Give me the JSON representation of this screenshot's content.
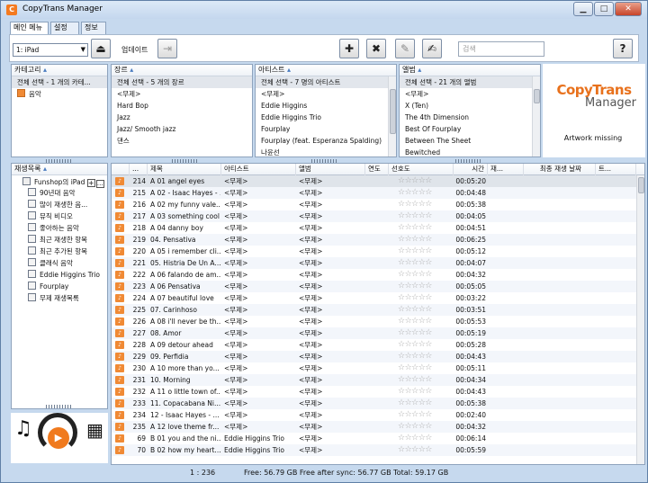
{
  "window": {
    "title": "CopyTrans Manager",
    "minimize": "▁",
    "maximize": "□",
    "close": "✕"
  },
  "tabs": [
    "메인 메뉴",
    "설정",
    "정보"
  ],
  "toolbar": {
    "device": "1: iPad",
    "update_label": "업데이트",
    "search_placeholder": "검색",
    "help_label": "?"
  },
  "categories": {
    "header": "카테고리",
    "items": [
      "전체 선택 - 1 개의 카테...",
      "음악"
    ]
  },
  "genres": {
    "header": "장르",
    "items": [
      "전체 선택 - 5 개의 장르",
      "<무제>",
      "Hard Bop",
      "Jazz",
      "Jazz/ Smooth jazz",
      "댄스"
    ]
  },
  "artists": {
    "header": "아티스트",
    "items": [
      "전체 선택 - 7 명의 아티스트",
      "<무제>",
      "Eddie Higgins",
      "Eddie Higgins Trio",
      "Fourplay",
      "Fourplay (feat.  Esperanza Spalding)",
      "나윤선"
    ]
  },
  "albums": {
    "header": "앨범",
    "items": [
      "전체 선택 - 21 개의 앨범",
      "<무제>",
      "X (Ten)",
      "The 4th Dimension",
      "Best Of Fourplay",
      "Between The Sheet",
      "Bewitched"
    ]
  },
  "artwork": {
    "logo_top": "CopyTrans",
    "logo_bottom": "Manager",
    "message": "Artwork missing"
  },
  "playlists": {
    "header": "재생목록",
    "device": "Funshop의 iPad",
    "items": [
      "90년대 음악",
      "많이 재생한 음...",
      "뮤직 비디오",
      "좋아하는 음악",
      "최근 재생한 항목",
      "최근 추가된 항목",
      "클래식 음악",
      "Eddie Higgins Trio",
      "Fourplay",
      "무제 재생목록"
    ]
  },
  "table": {
    "columns": [
      "...",
      "제목",
      "아티스트",
      "앨범",
      "연도",
      "선호도",
      "시간",
      "재...",
      "최종 재생 날짜",
      "트..."
    ],
    "rows": [
      [
        "214",
        "A 01 angel eyes",
        "<무제>",
        "<무제>",
        "00:05:20"
      ],
      [
        "215",
        "A 02 - Isaac Hayes - ...",
        "<무제>",
        "<무제>",
        "00:04:48"
      ],
      [
        "216",
        "A 02 my funny vale...",
        "<무제>",
        "<무제>",
        "00:05:38"
      ],
      [
        "217",
        "A 03 something cool",
        "<무제>",
        "<무제>",
        "00:04:05"
      ],
      [
        "218",
        "A 04 danny boy",
        "<무제>",
        "<무제>",
        "00:04:51"
      ],
      [
        "219",
        "04. Pensativa",
        "<무제>",
        "<무제>",
        "00:06:25"
      ],
      [
        "220",
        "A 05 i remember cli...",
        "<무제>",
        "<무제>",
        "00:05:12"
      ],
      [
        "221",
        "05. Histria De Un A...",
        "<무제>",
        "<무제>",
        "00:04:07"
      ],
      [
        "222",
        "A 06 falando de am...",
        "<무제>",
        "<무제>",
        "00:04:32"
      ],
      [
        "223",
        "A 06 Pensativa",
        "<무제>",
        "<무제>",
        "00:05:05"
      ],
      [
        "224",
        "A 07 beautiful love",
        "<무제>",
        "<무제>",
        "00:03:22"
      ],
      [
        "225",
        "07. Carinhoso",
        "<무제>",
        "<무제>",
        "00:03:51"
      ],
      [
        "226",
        "A 08 i'll never be th...",
        "<무제>",
        "<무제>",
        "00:05:53"
      ],
      [
        "227",
        "08. Amor",
        "<무제>",
        "<무제>",
        "00:05:19"
      ],
      [
        "228",
        "A 09 detour ahead",
        "<무제>",
        "<무제>",
        "00:05:28"
      ],
      [
        "229",
        "09. Perfidia",
        "<무제>",
        "<무제>",
        "00:04:43"
      ],
      [
        "230",
        "A 10 more than yo...",
        "<무제>",
        "<무제>",
        "00:05:11"
      ],
      [
        "231",
        "10. Morning",
        "<무제>",
        "<무제>",
        "00:04:34"
      ],
      [
        "232",
        "A 11 o little town of...",
        "<무제>",
        "<무제>",
        "00:04:43"
      ],
      [
        "233",
        "11. Copacabana Ni...",
        "<무제>",
        "<무제>",
        "00:05:38"
      ],
      [
        "234",
        "12 - Isaac Hayes - ...",
        "<무제>",
        "<무제>",
        "00:02:40"
      ],
      [
        "235",
        "A 12 love theme fr...",
        "<무제>",
        "<무제>",
        "00:04:32"
      ],
      [
        "69",
        "B 01 you and the ni...",
        "Eddie Higgins Trio",
        "<무제>",
        "00:06:14"
      ],
      [
        "70",
        "B 02 how my heart...",
        "Eddie Higgins Trio",
        "<무제>",
        "00:05:59"
      ]
    ]
  },
  "status": {
    "count": "1 : 236",
    "free": "Free: 56.79 GB Free after sync: 56.77 GB Total: 59.17 GB"
  }
}
